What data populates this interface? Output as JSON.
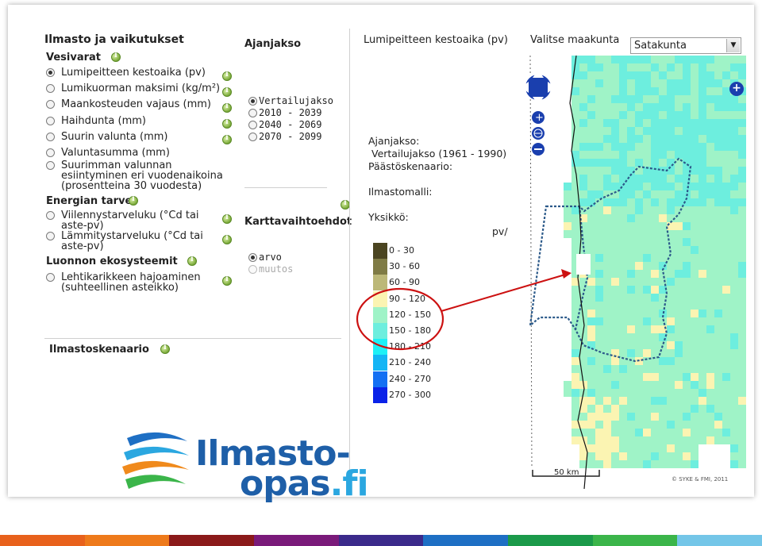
{
  "sidebar": {
    "title": "Ilmasto ja vaikutukset",
    "sections": [
      {
        "heading": "Vesivarat",
        "items": [
          {
            "label": "Lumipeitteen kestoaika (pv)",
            "checked": true
          },
          {
            "label": "Lumikuorman maksimi (kg/m²)"
          },
          {
            "label": "Maankosteuden vajaus (mm)"
          },
          {
            "label": "Haihdunta (mm)"
          },
          {
            "label": "Suurin valunta (mm)"
          },
          {
            "label": "Valuntasumma (mm)"
          },
          {
            "label": "Suurimman valunnan\nesiintyminen eri vuodenaikoina\n(prosentteina 30 vuodesta)"
          }
        ]
      },
      {
        "heading": "Energian tarve",
        "items": [
          {
            "label": "Viilennystarveluku (°Cd tai\naste-pv)"
          },
          {
            "label": "Lämmitystarveluku (°Cd tai\naste-pv)"
          }
        ]
      },
      {
        "heading": "Luonnon ekosysteemit",
        "items": [
          {
            "label": "Lehtikarikkeen hajoaminen\n(suhteellinen asteikko)"
          }
        ]
      }
    ],
    "scenario_heading": "Ilmastoskenaario"
  },
  "period": {
    "heading": "Ajanjakso",
    "options": [
      "Vertailujakso",
      "2010 - 2039",
      "2040 - 2069",
      "2070 - 2099"
    ],
    "selected": 0
  },
  "map_options": {
    "heading": "Karttavaihtoehdot",
    "options": [
      "arvo",
      "muutos"
    ],
    "selected": 0,
    "disabled": [
      1
    ]
  },
  "map_header": {
    "title": "Lumipeitteen kestoaika (pv)",
    "region_label": "Valitse maakunta",
    "region_value": "Satakunta"
  },
  "map_info": {
    "period_label": "Ajanjakso:",
    "period_value": "Vertailujakso (1961 - 1990)",
    "scenario_label": "Päästöskenaario:",
    "scenario_value": "-",
    "model_label": "Ilmastomalli:",
    "model_value": "-",
    "unit_label": "Yksikkö:",
    "unit_value": "pv/v"
  },
  "legend": [
    {
      "label": "0 - 30",
      "color": "#4b4521"
    },
    {
      "label": "30 - 60",
      "color": "#7f7b45"
    },
    {
      "label": "60 - 90",
      "color": "#bcb878"
    },
    {
      "label": "90 - 120",
      "color": "#fbf4b2"
    },
    {
      "label": "120 - 150",
      "color": "#9ff3c7"
    },
    {
      "label": "150 - 180",
      "color": "#6deede"
    },
    {
      "label": "180 - 210",
      "color": "#1ef0f6"
    },
    {
      "label": "210 - 240",
      "color": "#14b5f5"
    },
    {
      "label": "240 - 270",
      "color": "#1470f3"
    },
    {
      "label": "270 - 300",
      "color": "#0a22e8"
    }
  ],
  "scale_bar": "50 km",
  "copyright": "© SYKE & FMI, 2011",
  "logo": {
    "line1": "Ilmasto-",
    "line2": "opas",
    "line3": ".fi"
  },
  "annotation": {
    "circle_color": "#cc1111",
    "arrow_color": "#cc1111"
  },
  "bottom_bar_colors": [
    "#e8611c",
    "#ee7a1b",
    "#8b1a1a",
    "#7a1a7a",
    "#3b2a8b",
    "#1e6fc4",
    "#1b9a4a",
    "#3bb54a",
    "#74c6e8"
  ]
}
